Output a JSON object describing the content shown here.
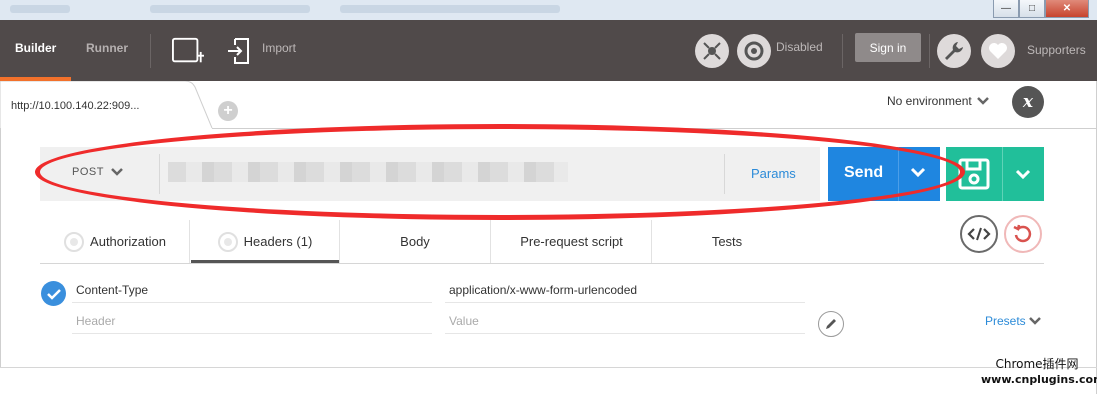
{
  "header": {
    "tabs": [
      {
        "label": "Builder",
        "active": true
      },
      {
        "label": "Runner",
        "active": false
      }
    ],
    "import_label": "Import",
    "sync_status": "Disabled",
    "signin_label": "Sign in",
    "supporters_label": "Supporters",
    "accent_color": "#f2712b",
    "background_color": "#504a4a"
  },
  "request_tab": {
    "title": "http://10.100.140.22:909...",
    "add_tab_label": "+"
  },
  "environment": {
    "selected": "No environment",
    "icon": "x-icon"
  },
  "request": {
    "method": "POST",
    "url": "",
    "params_label": "Params",
    "send_label": "Send",
    "send_color": "#1f86e0",
    "save_color": "#21bf9a"
  },
  "subtabs": [
    {
      "label": "Authorization",
      "radio": true
    },
    {
      "label": "Headers (1)",
      "radio": true,
      "active": true
    },
    {
      "label": "Body"
    },
    {
      "label": "Pre-request script"
    },
    {
      "label": "Tests"
    }
  ],
  "headers_table": {
    "rows": [
      {
        "key": "Content-Type",
        "value": "application/x-www-form-urlencoded",
        "enabled": true
      }
    ],
    "key_placeholder": "Header",
    "value_placeholder": "Value",
    "presets_label": "Presets"
  },
  "watermark": {
    "line1": "Chrome插件网",
    "line2": "www.cnplugins.com"
  }
}
